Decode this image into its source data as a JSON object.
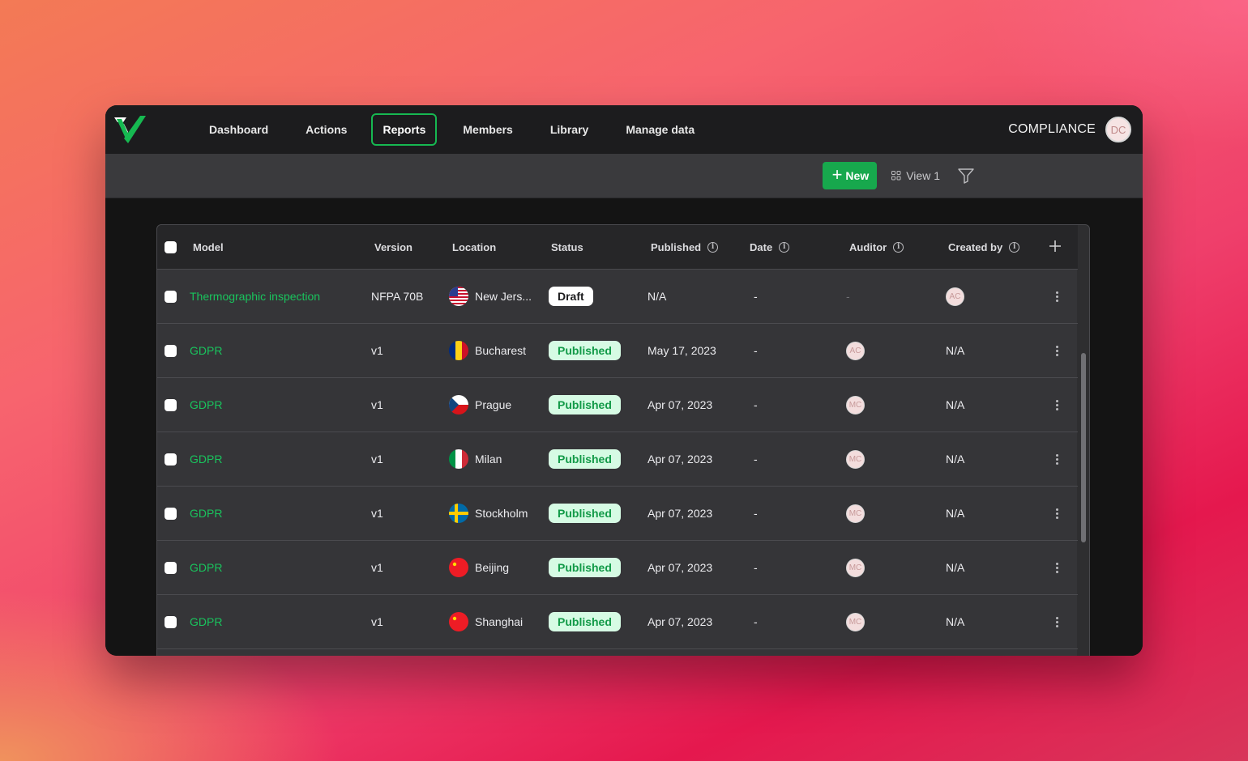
{
  "nav": {
    "items": [
      {
        "label": "Dashboard",
        "active": false
      },
      {
        "label": "Actions",
        "active": false
      },
      {
        "label": "Reports",
        "active": true
      },
      {
        "label": "Members",
        "active": false
      },
      {
        "label": "Library",
        "active": false
      },
      {
        "label": "Manage data",
        "active": false
      }
    ],
    "org_name": "COMPLIANCE",
    "user_initials": "DC"
  },
  "toolbar": {
    "new_label": "New",
    "view_label": "View 1"
  },
  "table": {
    "columns": [
      "Model",
      "Version",
      "Location",
      "Status",
      "Published",
      "Date",
      "Auditor",
      "Created by"
    ],
    "rows": [
      {
        "model": "Thermographic inspection",
        "version": "NFPA 70B",
        "flag": "us",
        "location": "New Jers...",
        "status": "Draft",
        "published": "N/A",
        "date": "-",
        "auditor": "-",
        "created_by": "AC"
      },
      {
        "model": "GDPR",
        "version": "v1",
        "flag": "ro",
        "location": "Bucharest",
        "status": "Published",
        "published": "May 17, 2023",
        "date": "-",
        "auditor": "AC",
        "created_by": "N/A"
      },
      {
        "model": "GDPR",
        "version": "v1",
        "flag": "cz",
        "location": "Prague",
        "status": "Published",
        "published": "Apr 07, 2023",
        "date": "-",
        "auditor": "MC",
        "created_by": "N/A"
      },
      {
        "model": "GDPR",
        "version": "v1",
        "flag": "it",
        "location": "Milan",
        "status": "Published",
        "published": "Apr 07, 2023",
        "date": "-",
        "auditor": "MC",
        "created_by": "N/A"
      },
      {
        "model": "GDPR",
        "version": "v1",
        "flag": "se",
        "location": "Stockholm",
        "status": "Published",
        "published": "Apr 07, 2023",
        "date": "-",
        "auditor": "MC",
        "created_by": "N/A"
      },
      {
        "model": "GDPR",
        "version": "v1",
        "flag": "cn",
        "location": "Beijing",
        "status": "Published",
        "published": "Apr 07, 2023",
        "date": "-",
        "auditor": "MC",
        "created_by": "N/A"
      },
      {
        "model": "GDPR",
        "version": "v1",
        "flag": "cn",
        "location": "Shanghai",
        "status": "Published",
        "published": "Apr 07, 2023",
        "date": "-",
        "auditor": "MC",
        "created_by": "N/A"
      }
    ]
  },
  "colors": {
    "accent_green": "#16b851",
    "link_green": "#19c45d",
    "published_bg": "#d6fbe4"
  }
}
